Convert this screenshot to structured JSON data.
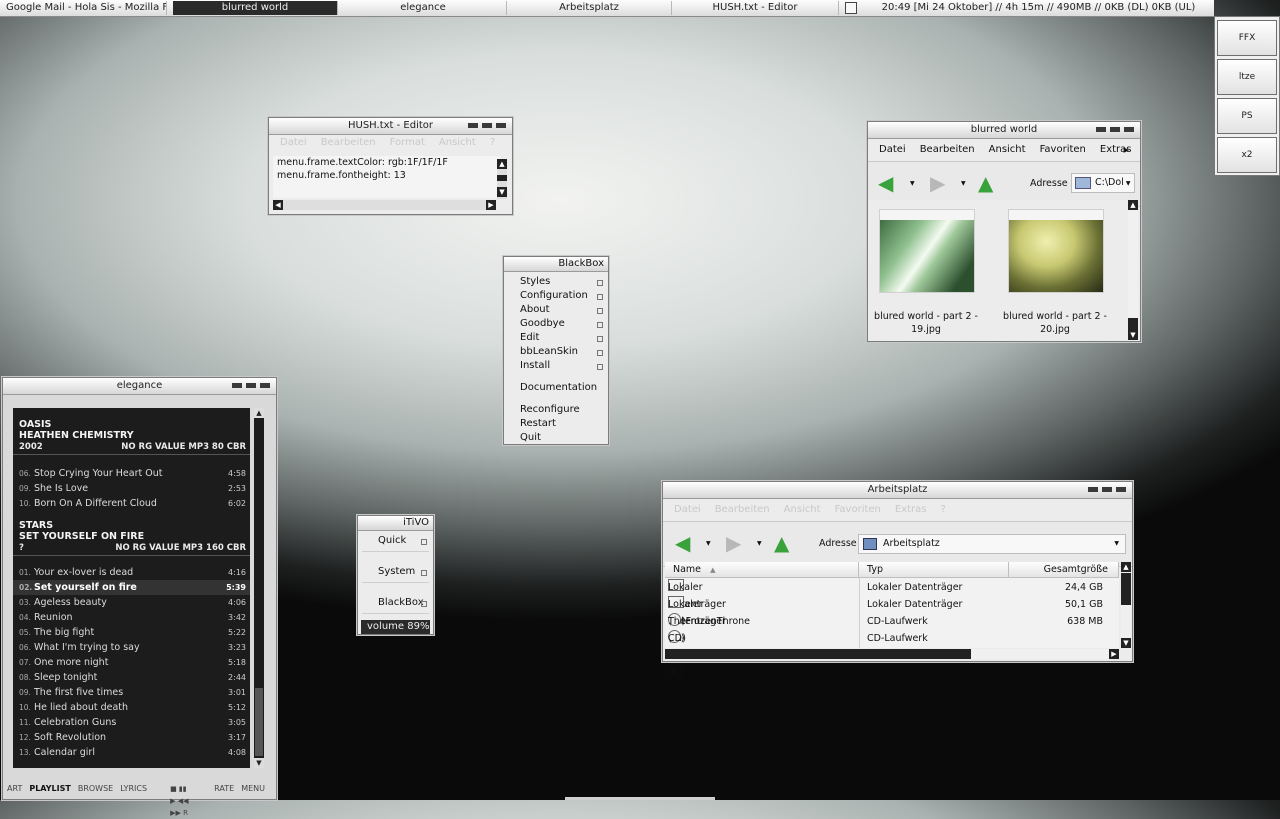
{
  "taskbar": {
    "tasks": [
      "Google Mail - Hola Sis - Mozilla Fi...",
      "blurred world",
      "elegance",
      "Arbeitsplatz",
      "HUSH.txt - Editor"
    ],
    "clock": "20:49  [Mi 24 Oktober] // 4h 15m // 490MB // 0KB (DL)  0KB (UL)"
  },
  "launcher": [
    "FFX",
    "ltze",
    "PS",
    "x2"
  ],
  "editor": {
    "title": "HUSH.txt - Editor",
    "menu": [
      "Datei",
      "Bearbeiten",
      "Format",
      "Ansicht",
      "?"
    ],
    "lines": [
      "menu.frame.textColor: rgb:1F/1F/1F",
      "menu.frame.fontheight: 13"
    ]
  },
  "explorer1": {
    "title": "blurred world",
    "menu": [
      "Datei",
      "Bearbeiten",
      "Ansicht",
      "Favoriten",
      "Extras"
    ],
    "address_label": "Adresse",
    "address": "C:\\Dol",
    "files": [
      {
        "name_line1": "blured world - part 2 -",
        "name_line2": "19.jpg"
      },
      {
        "name_line1": "blured world - part 2 -",
        "name_line2": "20.jpg"
      }
    ]
  },
  "blackbox": {
    "title": "BlackBox",
    "items": [
      "Styles",
      "Configuration",
      "About",
      "Goodbye",
      "Edit",
      "bbLeanSkin",
      "Install"
    ],
    "documentation": "Documentation",
    "actions": [
      "Reconfigure",
      "Restart",
      "Quit"
    ]
  },
  "itivo": {
    "title": "iTiVO",
    "items": [
      "Quick",
      "System",
      "BlackBox"
    ],
    "volume": "volume 89%"
  },
  "player": {
    "title": "elegance",
    "albums": [
      {
        "artist": "OASIS",
        "album": "HEATHEN CHEMISTRY",
        "year": "2002",
        "info": "NO RG VALUE  MP3 80 CBR",
        "tracks": [
          {
            "no": "06.",
            "title": "Stop Crying Your Heart Out",
            "dur": "4:58"
          },
          {
            "no": "09.",
            "title": "She Is Love",
            "dur": "2:53"
          },
          {
            "no": "10.",
            "title": "Born On A Different Cloud",
            "dur": "6:02"
          }
        ]
      },
      {
        "artist": "STARS",
        "album": "SET YOURSELF ON FIRE",
        "year": "?",
        "info": "NO RG VALUE  MP3 160 CBR",
        "tracks": [
          {
            "no": "01.",
            "title": "Your ex-lover is dead",
            "dur": "4:16"
          },
          {
            "no": "02.",
            "title": "Set yourself on fire",
            "dur": "5:39"
          },
          {
            "no": "03.",
            "title": "Ageless beauty",
            "dur": "4:06"
          },
          {
            "no": "04.",
            "title": "Reunion",
            "dur": "3:42"
          },
          {
            "no": "05.",
            "title": "The big fight",
            "dur": "5:22"
          },
          {
            "no": "06.",
            "title": "What I'm trying to say",
            "dur": "3:23"
          },
          {
            "no": "07.",
            "title": "One more night",
            "dur": "5:18"
          },
          {
            "no": "08.",
            "title": "Sleep tonight",
            "dur": "2:44"
          },
          {
            "no": "09.",
            "title": "The first five times",
            "dur": "3:01"
          },
          {
            "no": "10.",
            "title": "He lied about death",
            "dur": "5:12"
          },
          {
            "no": "11.",
            "title": "Celebration Guns",
            "dur": "3:05"
          },
          {
            "no": "12.",
            "title": "Soft Revolution",
            "dur": "3:17"
          },
          {
            "no": "13.",
            "title": "Calendar girl",
            "dur": "4:08"
          }
        ]
      }
    ],
    "bottom_tabs": [
      "ART",
      "PLAYLIST",
      "BROWSE",
      "LYRICS"
    ],
    "bottom_right": [
      "RATE",
      "MENU"
    ],
    "transport": "■ ▮▮ ▶ ◀◀ ▶▶ R"
  },
  "explorer2": {
    "title": "Arbeitsplatz",
    "menu": [
      "Datei",
      "Bearbeiten",
      "Ansicht",
      "Favoriten",
      "Extras",
      "?"
    ],
    "address_label": "Adresse",
    "address": "Arbeitsplatz",
    "columns": [
      "Name",
      "Typ",
      "Gesamtgröße"
    ],
    "drives": [
      {
        "name": "Lokaler Datenträger (C:)",
        "type": "Lokaler Datenträger",
        "size": "24,4 GB",
        "kind": "hdd"
      },
      {
        "name": "Lokaler Datenträger (D:)",
        "type": "Lokaler Datenträger",
        "size": "50,1 GB",
        "kind": "hdd"
      },
      {
        "name": "TheFrozenThrone (E:)",
        "type": "CD-Laufwerk",
        "size": "638 MB",
        "kind": "cd"
      },
      {
        "name": "CD-Laufwerk (F:)",
        "type": "CD-Laufwerk",
        "size": "",
        "kind": "cd"
      }
    ]
  },
  "colors": {
    "nav_green": "#3aa23a",
    "nav_gray": "#b8b8b8",
    "dark_panel": "#1c1c1c"
  }
}
